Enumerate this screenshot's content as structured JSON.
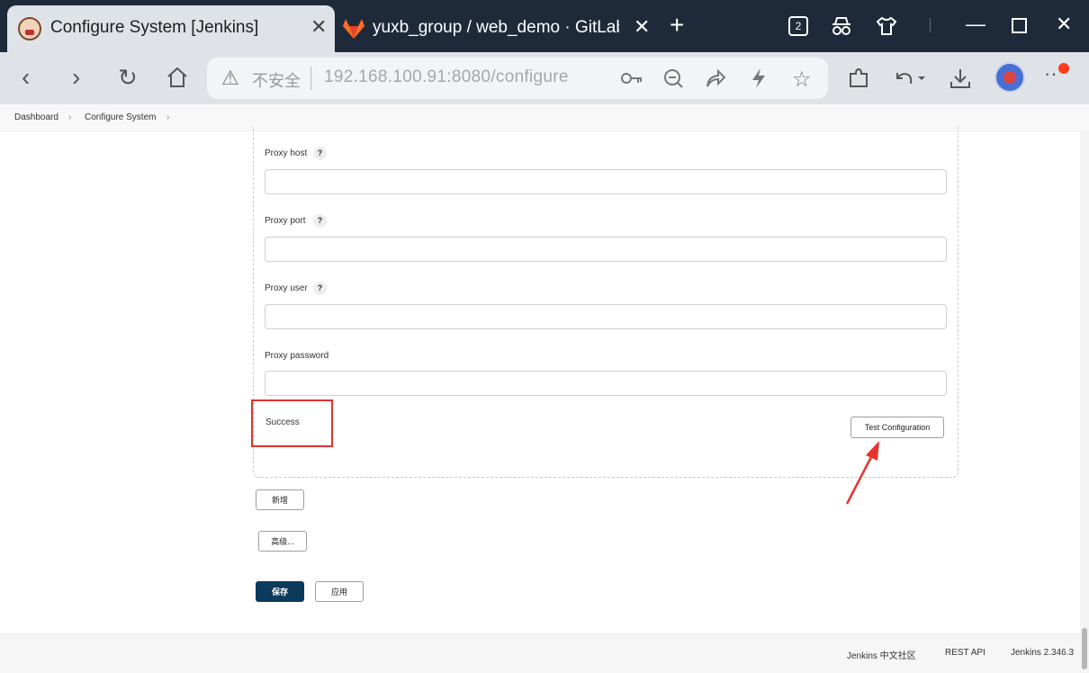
{
  "browser": {
    "tabs": [
      {
        "title": "Configure System [Jenkins]",
        "active": true
      },
      {
        "title": "yuxb_group / web_demo · GitLab",
        "active": false
      }
    ],
    "tab_count_badge": "2",
    "address": {
      "insecure_label": "不安全",
      "url": "192.168.100.91:8080/configure"
    }
  },
  "breadcrumb": [
    "Dashboard",
    "Configure System"
  ],
  "form": {
    "proxy_host": {
      "label": "Proxy host",
      "value": ""
    },
    "proxy_port": {
      "label": "Proxy port",
      "value": ""
    },
    "proxy_user": {
      "label": "Proxy user",
      "value": ""
    },
    "proxy_password": {
      "label": "Proxy password",
      "value": ""
    },
    "help_glyph": "?",
    "status_text": "Success",
    "test_button": "Test Configuration"
  },
  "buttons": {
    "add": "新增",
    "advanced": "高级...",
    "save": "保存",
    "apply": "应用"
  },
  "footer": {
    "community": "Jenkins 中文社区",
    "rest_api": "REST API",
    "version": "Jenkins 2.346.3"
  },
  "colors": {
    "primary_button": "#0b3a5c",
    "highlight_box": "#e0332f",
    "annotation_arrow": "#e8332d"
  }
}
